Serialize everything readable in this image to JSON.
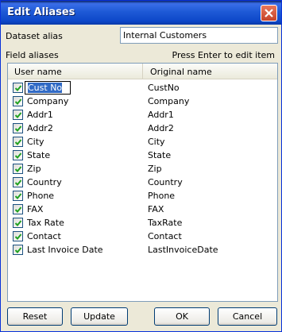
{
  "window": {
    "title": "Edit Aliases",
    "close_icon": "close-icon"
  },
  "dataset": {
    "label": "Dataset alias",
    "value": "Internal Customers"
  },
  "fields": {
    "label": "Field aliases",
    "hint": "Press Enter to edit item"
  },
  "columns": {
    "user": "User name",
    "original": "Original name"
  },
  "rows": [
    {
      "user": "Cust No",
      "original": "CustNo",
      "checked": true,
      "editing": true
    },
    {
      "user": "Company",
      "original": "Company",
      "checked": true
    },
    {
      "user": "Addr1",
      "original": "Addr1",
      "checked": true
    },
    {
      "user": "Addr2",
      "original": "Addr2",
      "checked": true
    },
    {
      "user": "City",
      "original": "City",
      "checked": true
    },
    {
      "user": "State",
      "original": "State",
      "checked": true
    },
    {
      "user": "Zip",
      "original": "Zip",
      "checked": true
    },
    {
      "user": "Country",
      "original": "Country",
      "checked": true
    },
    {
      "user": "Phone",
      "original": "Phone",
      "checked": true
    },
    {
      "user": "FAX",
      "original": "FAX",
      "checked": true
    },
    {
      "user": "Tax Rate",
      "original": "TaxRate",
      "checked": true
    },
    {
      "user": "Contact",
      "original": "Contact",
      "checked": true
    },
    {
      "user": "Last Invoice Date",
      "original": "LastInvoiceDate",
      "checked": true
    }
  ],
  "buttons": {
    "reset": "Reset",
    "update": "Update",
    "ok": "OK",
    "cancel": "Cancel"
  },
  "colors": {
    "titlebar": "#0d47c9",
    "selection": "#316ac5",
    "check": "#21a121"
  }
}
